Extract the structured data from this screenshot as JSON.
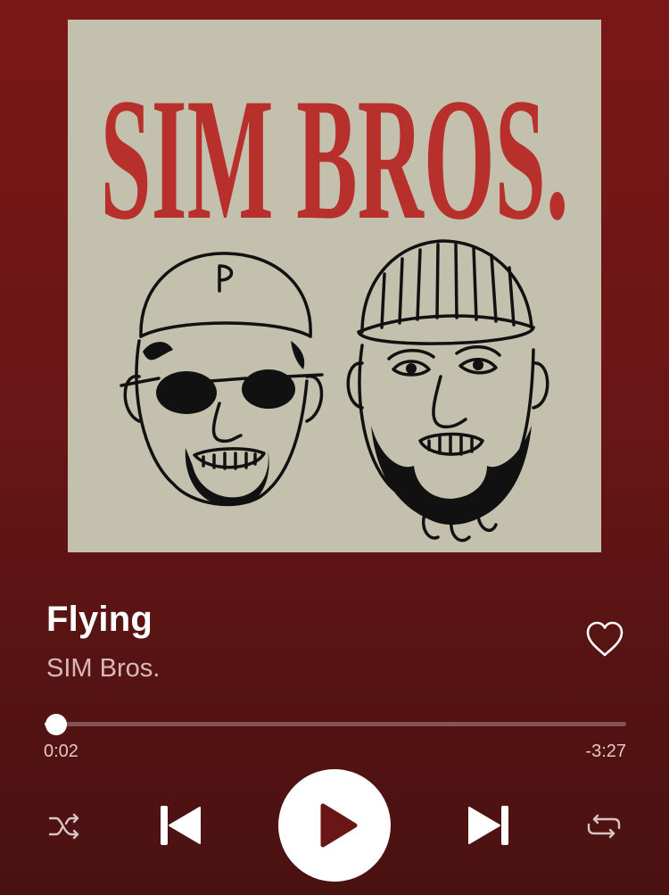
{
  "album": {
    "art_title": "SIM BROS.",
    "art_icon": "album-cover-illustration"
  },
  "track": {
    "title": "Flying",
    "artist": "SIM Bros.",
    "liked": false
  },
  "playback": {
    "elapsed": "0:02",
    "remaining": "-3:27",
    "progress_fraction": 0.02,
    "state": "paused"
  },
  "controls": {
    "shuffle_icon": "shuffle-icon",
    "previous_icon": "skip-previous-icon",
    "play_icon": "play-icon",
    "next_icon": "skip-next-icon",
    "repeat_icon": "repeat-icon",
    "like_icon": "heart-outline-icon"
  },
  "colors": {
    "background_top": "#7a1717",
    "background_bottom": "#4a1111",
    "art_background": "#c4c0ae",
    "art_title": "#b8302c"
  }
}
